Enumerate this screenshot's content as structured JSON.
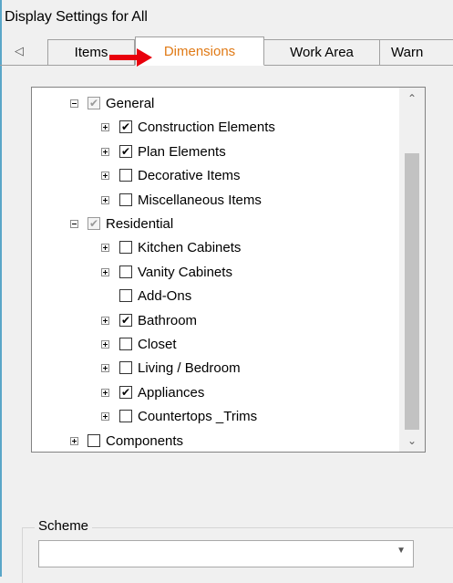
{
  "window": {
    "title": "Display Settings for All"
  },
  "tabs": {
    "scroll_left_icon": "triangle-left",
    "items": [
      {
        "label": "Items",
        "active": false
      },
      {
        "label": "Dimensions",
        "active": true
      },
      {
        "label": "Work Area",
        "active": false
      },
      {
        "label": "Warn",
        "active": false
      }
    ]
  },
  "annotation": {
    "arrow_color": "#e8000c"
  },
  "tree": {
    "nodes": [
      {
        "label": "General",
        "state": "partial",
        "expander": "minus"
      },
      {
        "label": "Construction Elements",
        "state": "checked",
        "expander": "plus"
      },
      {
        "label": "Plan Elements",
        "state": "checked",
        "expander": "plus"
      },
      {
        "label": "Decorative Items",
        "state": "unchecked",
        "expander": "plus"
      },
      {
        "label": "Miscellaneous Items",
        "state": "unchecked",
        "expander": "plus"
      },
      {
        "label": "Residential",
        "state": "partial",
        "expander": "minus"
      },
      {
        "label": "Kitchen Cabinets",
        "state": "unchecked",
        "expander": "plus"
      },
      {
        "label": "Vanity Cabinets",
        "state": "unchecked",
        "expander": "plus"
      },
      {
        "label": "Add-Ons",
        "state": "unchecked",
        "expander": "none"
      },
      {
        "label": "Bathroom",
        "state": "checked",
        "expander": "plus"
      },
      {
        "label": "Closet",
        "state": "unchecked",
        "expander": "plus"
      },
      {
        "label": "Living / Bedroom",
        "state": "unchecked",
        "expander": "plus"
      },
      {
        "label": "Appliances",
        "state": "checked",
        "expander": "plus"
      },
      {
        "label": "Countertops _Trims",
        "state": "unchecked",
        "expander": "plus"
      },
      {
        "label": "Components",
        "state": "unchecked",
        "expander": "plus"
      }
    ]
  },
  "scheme": {
    "label": "Scheme",
    "value": ""
  },
  "colors": {
    "active_tab_text": "#e07a16",
    "scrollbar_thumb": "#c2c2c2"
  }
}
